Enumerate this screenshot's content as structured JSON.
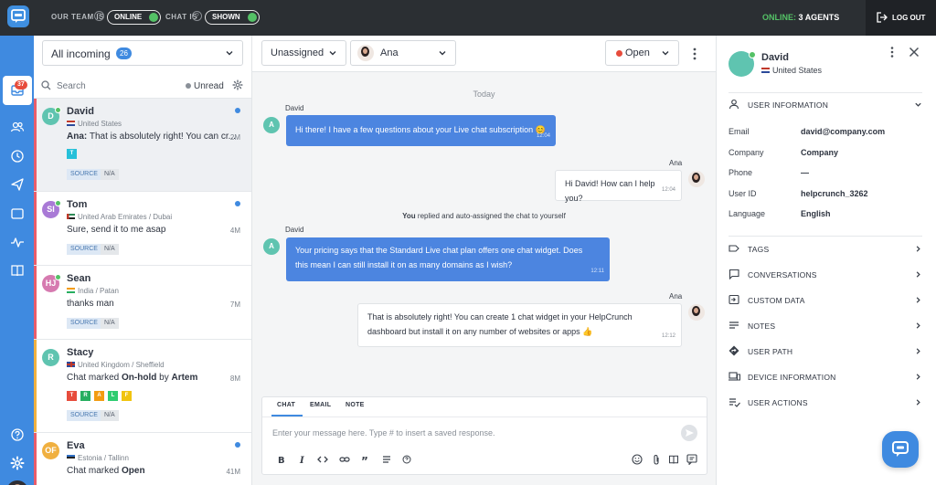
{
  "topbar": {
    "team_label": "OUR TEAM IS",
    "team_status": "ONLINE",
    "chat_label": "CHAT IS",
    "chat_status": "SHOWN",
    "online_prefix": "ONLINE:",
    "online_agents": "3 AGENTS",
    "logout": "LOG OUT",
    "accent": "#3f8ae0",
    "online_color": "#54c166"
  },
  "sidebar": {
    "badge": "37",
    "icons": [
      "inbox-icon",
      "contacts-icon",
      "clock-icon",
      "send-icon",
      "widget-icon",
      "activity-icon",
      "book-icon",
      "help-icon",
      "settings-icon"
    ]
  },
  "list": {
    "filter": "All incoming",
    "filter_count": "26",
    "search_placeholder": "Search",
    "unread_label": "Unread",
    "chats": [
      {
        "initial": "D",
        "name": "David",
        "location": "United States",
        "message_author": "Ana:",
        "message": "That is absolutely right! You can cr...",
        "time": "2M",
        "source_label": "SOURCE",
        "source_value": "N/A",
        "labels": [
          "T"
        ],
        "color": "#5fc4b0"
      },
      {
        "initial": "SI",
        "name": "Tom",
        "location": "United Arab Emirates / Dubai",
        "message": "Sure, send it to me asap",
        "time": "4M",
        "source_label": "SOURCE",
        "source_value": "N/A",
        "color": "#a97ad6"
      },
      {
        "initial": "HJ",
        "name": "Sean",
        "location": "India / Patan",
        "message": "thanks man",
        "time": "7M",
        "source_label": "SOURCE",
        "source_value": "N/A",
        "color": "#d67ab0"
      },
      {
        "initial": "R",
        "name": "Stacy",
        "location": "United Kingdom / Sheffield",
        "message_prefix": "Chat marked",
        "message_bold": "On-hold",
        "message_mid": "by",
        "message_bold2": "Artem",
        "time": "8M",
        "labels": [
          "T",
          "R",
          "A",
          "L",
          "F"
        ],
        "source_label": "SOURCE",
        "source_value": "N/A",
        "color": "#5fc4b0"
      },
      {
        "initial": "OF",
        "name": "Eva",
        "location": "Estonia / Tallinn",
        "message_prefix": "Chat marked",
        "message_bold": "Open",
        "time": "41M",
        "color": "#f0b040"
      }
    ]
  },
  "conversation": {
    "assignee": "Unassigned",
    "agent": "Ana",
    "status": "Open",
    "day": "Today",
    "messages": [
      {
        "sender": "David",
        "initial": "A",
        "text": "Hi there! I have a few questions about your Live chat subscription 😊",
        "time": "12:04"
      },
      {
        "sender": "Ana",
        "text": "Hi David! How can I help you?",
        "time": "12:04"
      },
      {
        "sender": "David",
        "initial": "A",
        "text_line1": "Your pricing says that the Standard Live chat plan offers one chat widget. Does",
        "text_line2": "this mean I can still install it on as many domains as I wish?",
        "time": "12:11"
      },
      {
        "sender": "Ana",
        "text_line1": "That is absolutely right! You can create 1 chat widget in your HelpCrunch",
        "text_line2": "dashboard but install it on any number of websites or apps 👍",
        "time": "12:12"
      }
    ],
    "system_bold": "You",
    "system_text": "replied and auto-assigned the chat to yourself",
    "composer_tabs": [
      "CHAT",
      "EMAIL",
      "NOTE"
    ],
    "composer_placeholder": "Enter your message here. Type # to insert a saved response."
  },
  "info": {
    "name": "David",
    "location": "United States",
    "user_info_title": "USER INFORMATION",
    "fields": [
      {
        "key": "Email",
        "value": "david@company.com"
      },
      {
        "key": "Company",
        "value": "Company"
      },
      {
        "key": "Phone",
        "value": "—"
      },
      {
        "key": "User ID",
        "value": "helpcrunch_3262"
      },
      {
        "key": "Language",
        "value": "English"
      }
    ],
    "sections": [
      "TAGS",
      "CONVERSATIONS",
      "CUSTOM DATA",
      "NOTES",
      "USER PATH",
      "DEVICE INFORMATION",
      "USER ACTIONS"
    ]
  }
}
